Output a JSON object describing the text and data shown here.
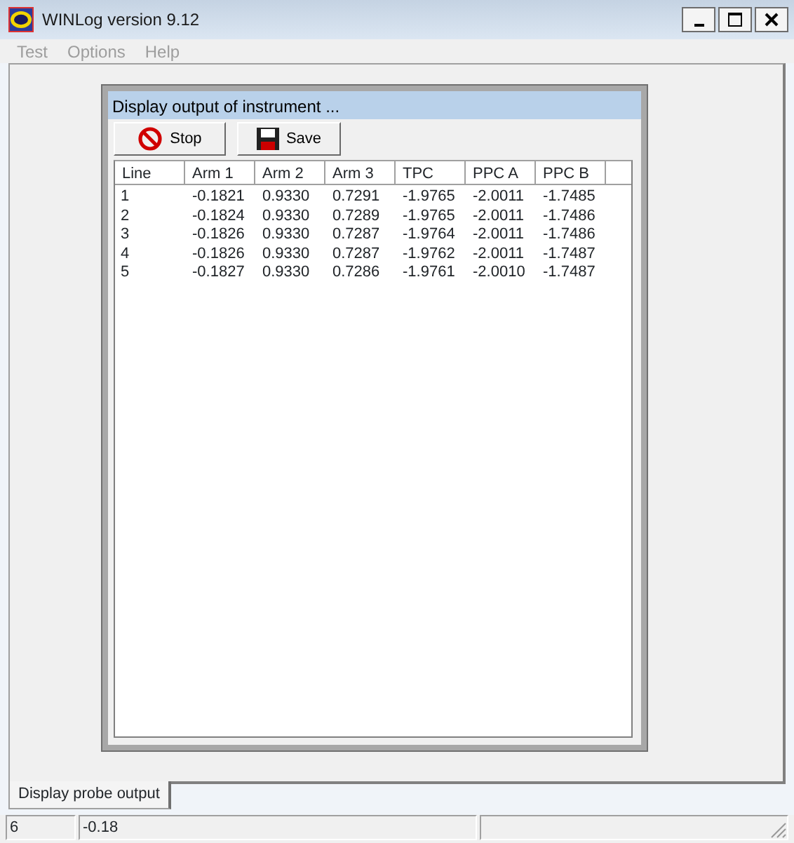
{
  "window": {
    "title": "WINLog version 9.12"
  },
  "menu": [
    {
      "label": "Test",
      "disabled": true
    },
    {
      "label": "Options",
      "disabled": true
    },
    {
      "label": "Help",
      "disabled": true
    }
  ],
  "child_window": {
    "title": "Display output of instrument ...",
    "toolbar": [
      {
        "label": "Stop",
        "kind": "stop"
      },
      {
        "label": "Save",
        "kind": "save"
      }
    ],
    "table": {
      "columns": [
        "Line",
        "Arm 1",
        "Arm 2",
        "Arm 3",
        "TPC",
        "PPC A",
        "PPC B"
      ],
      "rows": [
        [
          "1",
          "-0.1821",
          "0.9330",
          "0.7291",
          "-1.9765",
          "-2.0011",
          "-1.7485"
        ],
        [
          "2",
          "-0.1824",
          "0.9330",
          "0.7289",
          "-1.9765",
          "-2.0011",
          "-1.7486"
        ],
        [
          "3",
          "-0.1826",
          "0.9330",
          "0.7287",
          "-1.9764",
          "-2.0011",
          "-1.7486"
        ],
        [
          "4",
          "-0.1826",
          "0.9330",
          "0.7287",
          "-1.9762",
          "-2.0011",
          "-1.7487"
        ],
        [
          "5",
          "-0.1827",
          "0.9330",
          "0.7286",
          "-1.9761",
          "-2.0010",
          "-1.7487"
        ]
      ]
    }
  },
  "tabs": [
    {
      "label": "Display probe output",
      "selected": true
    }
  ],
  "status_bar": [
    "6",
    "-0.18"
  ]
}
